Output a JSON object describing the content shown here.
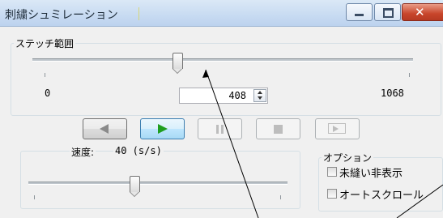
{
  "window": {
    "title": "刺繍シュミレーション",
    "colors": {
      "title_bar": "#c9dcf2",
      "close_button": "#c8452b",
      "client": "#f0f0f0"
    }
  },
  "stitch_range": {
    "label": "ステッチ範囲",
    "min_label": "0",
    "max_label": "1068",
    "current_value": "408",
    "slider_fraction": 0.38
  },
  "playback": {
    "buttons": [
      {
        "name": "previous",
        "icon": "triangle-left-icon",
        "state": "normal"
      },
      {
        "name": "play",
        "icon": "play-icon",
        "state": "active"
      },
      {
        "name": "pause",
        "icon": "pause-icon",
        "state": "disabled"
      },
      {
        "name": "stop",
        "icon": "stop-icon",
        "state": "disabled"
      },
      {
        "name": "export",
        "icon": "export-icon",
        "state": "disabled"
      }
    ]
  },
  "speed": {
    "label": "速度:",
    "value_text": "40 (s/s)",
    "slider_fraction": 0.41
  },
  "options": {
    "label": "オプション",
    "items": [
      {
        "label": "未縫い非表示",
        "checked": false
      },
      {
        "label": "オートスクロール",
        "checked": false
      }
    ]
  }
}
